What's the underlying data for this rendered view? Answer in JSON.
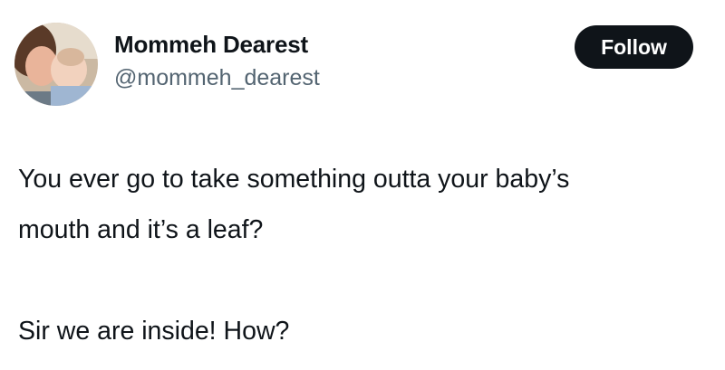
{
  "author": {
    "display_name": "Mommeh Dearest",
    "handle": "@mommeh_dearest",
    "avatar_icon": "profile-photo-mother-and-baby"
  },
  "actions": {
    "follow_label": "Follow"
  },
  "tweet": {
    "lines": [
      "You ever go to take something outta your baby’s",
      "mouth and it’s a leaf?",
      "Sir we are inside! How?"
    ]
  },
  "colors": {
    "button_bg": "#0f1419",
    "button_text": "#ffffff",
    "name_text": "#0f1419",
    "handle_text": "#536471"
  }
}
